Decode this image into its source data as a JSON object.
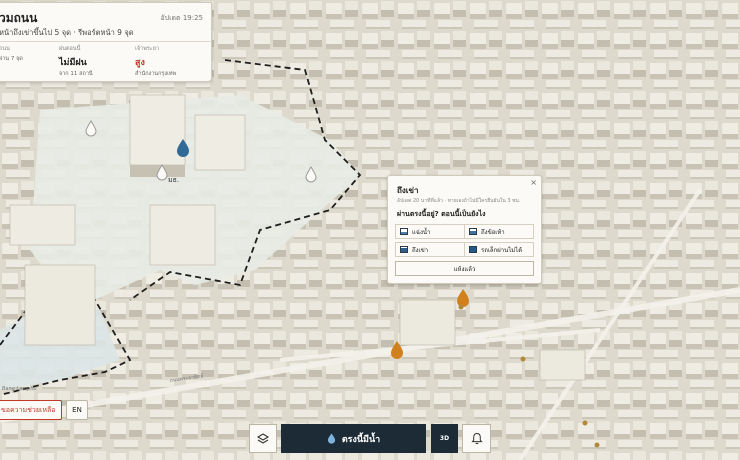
{
  "status_card": {
    "title": "วมถนน",
    "summary": "หน้าถึงเข่าขึ้นไป 5 จุด · รีพอร์ตหน้า 9 จุด",
    "updated": "อัปเดต 19:25",
    "stats": [
      {
        "label": "ถนน",
        "value": "",
        "sub": "ผ่าน 7 จุด"
      },
      {
        "label": "ฝนตอนนี้",
        "value": "ไม่มีฝน",
        "sub": "จาก 11 สถานี"
      },
      {
        "label": "เจ้าพระยา",
        "value": "สูง",
        "sub": "สำนักงานกรุงเทพ",
        "color": "#c0392b"
      }
    ]
  },
  "map": {
    "place_label": "มธ.",
    "street_labels": [
      "ถนนพระอาทิตย์",
      "Bang Lamphu"
    ]
  },
  "popup": {
    "title": "ถึงเข่า",
    "close_label": "×",
    "meta": "อัปเดต 20 นาทีที่แล้ว · หายเองถ้าไม่มีใครยืนยันใน 3 ชม.",
    "question": "ผ่านตรงนี้อยู่? ตอนนี้เป็นยังไง",
    "options": [
      {
        "label": "แฉ่งน้ำ",
        "icon": "water-level-low-icon"
      },
      {
        "label": "ถึงข้อเท้า",
        "icon": "water-level-ankle-icon"
      },
      {
        "label": "ถึงเข่า",
        "icon": "water-level-knee-icon"
      },
      {
        "label": "รถเล็กผ่านไม่ได้",
        "icon": "water-level-impassable-icon"
      }
    ],
    "submit_label": "แห้งแล้ว"
  },
  "bottom_left": {
    "help_label": "ขอความช่วยเหลือ",
    "lang_label": "EN"
  },
  "toolbar": {
    "layers_icon": "layers-icon",
    "report_label": "ตรงนี้มีน้ำ",
    "report_icon": "water-drop-icon",
    "three_d_label": "3D",
    "bell_icon": "bell-icon"
  },
  "colors": {
    "danger": "#c0392b",
    "toolbar_dark": "#1c2b36",
    "drop_blue": "#2f6a98",
    "drop_orange": "#d0811e",
    "water_blue": "#3f73a3"
  }
}
